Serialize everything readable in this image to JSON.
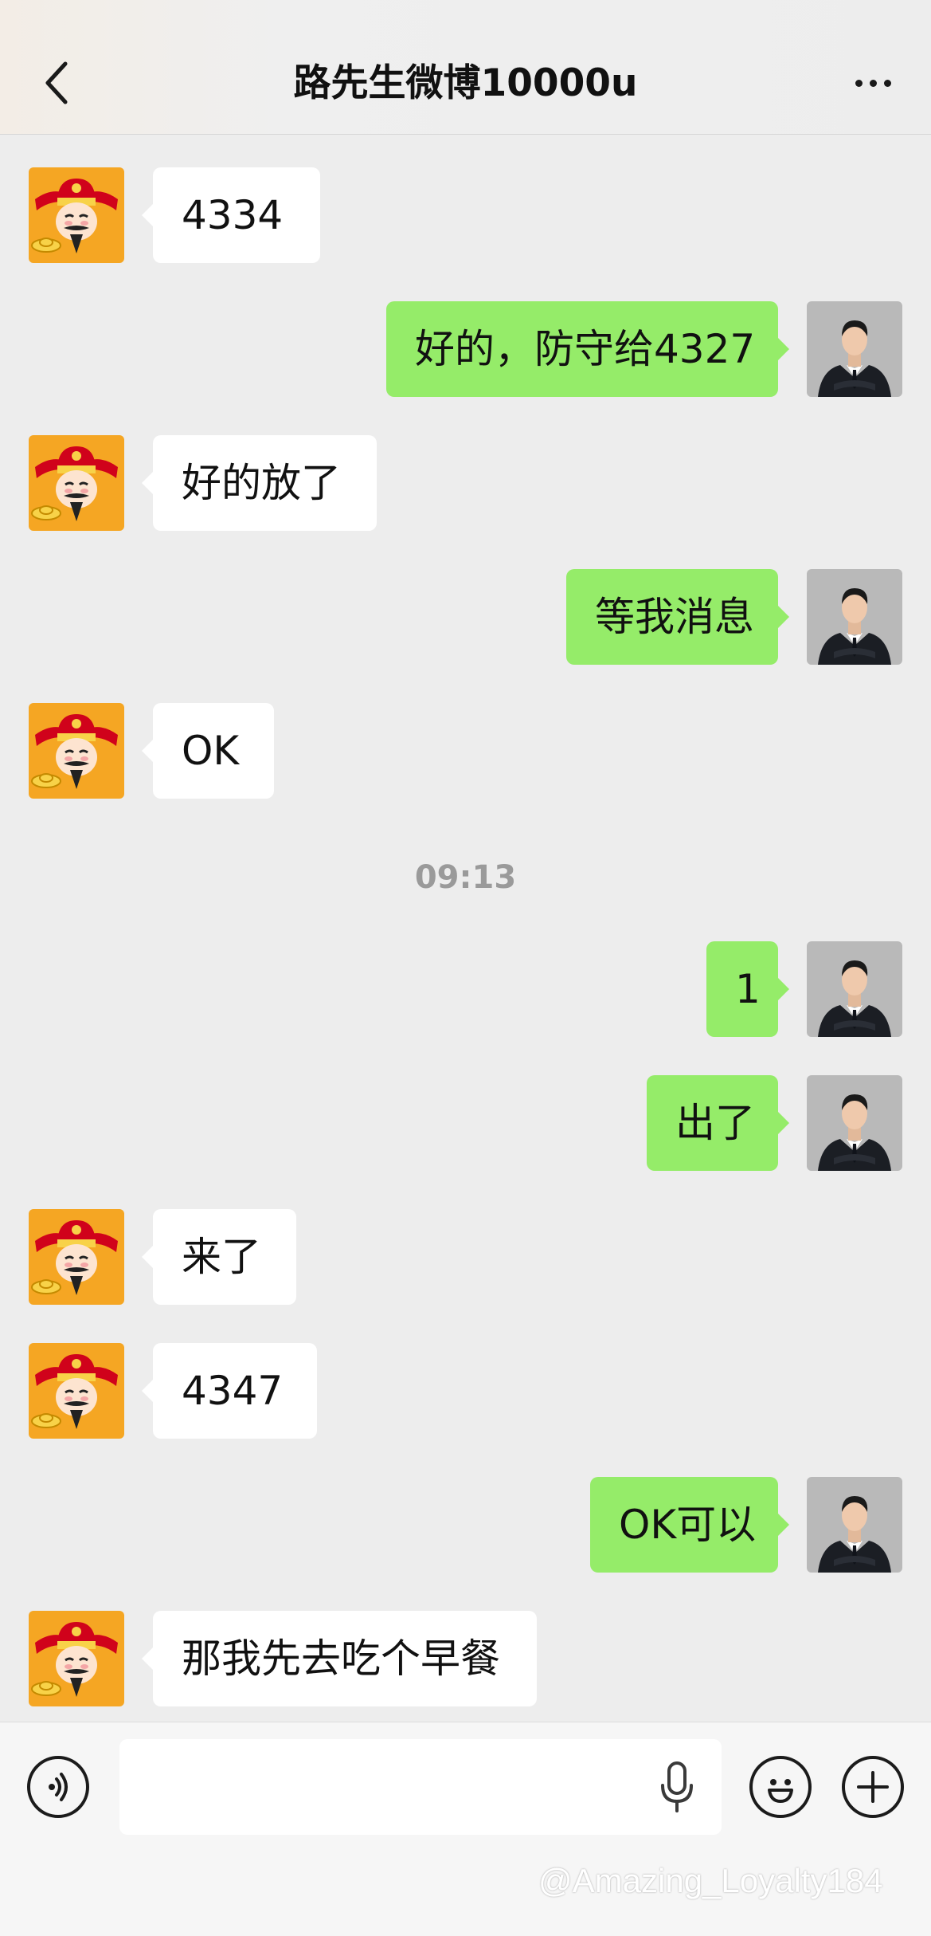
{
  "header": {
    "title": "路先生微博10000u"
  },
  "messages": [
    {
      "side": "in",
      "text": "4334"
    },
    {
      "side": "out",
      "text": "好的，防守给4327"
    },
    {
      "side": "in",
      "text": "好的放了"
    },
    {
      "side": "out",
      "text": "等我消息"
    },
    {
      "side": "in",
      "text": "OK"
    },
    {
      "side": "out",
      "text": "1"
    },
    {
      "side": "out",
      "text": "出了"
    },
    {
      "side": "in",
      "text": "来了"
    },
    {
      "side": "in",
      "text": "4347"
    },
    {
      "side": "out",
      "text": "OK可以"
    },
    {
      "side": "in",
      "text": "那我先去吃个早餐"
    }
  ],
  "timestamp": "09:13",
  "input": {
    "placeholder": ""
  },
  "watermark": "@Amazing_Loyalty184",
  "colors": {
    "outgoing_bubble": "#95ec69",
    "incoming_bubble": "#ffffff",
    "chat_background": "#ededed"
  },
  "icons": {
    "back": "chevron-left-icon",
    "more": "more-dots-icon",
    "voice": "voice-mode-icon",
    "mic": "mic-icon",
    "emoji": "emoji-icon",
    "plus": "plus-icon"
  }
}
